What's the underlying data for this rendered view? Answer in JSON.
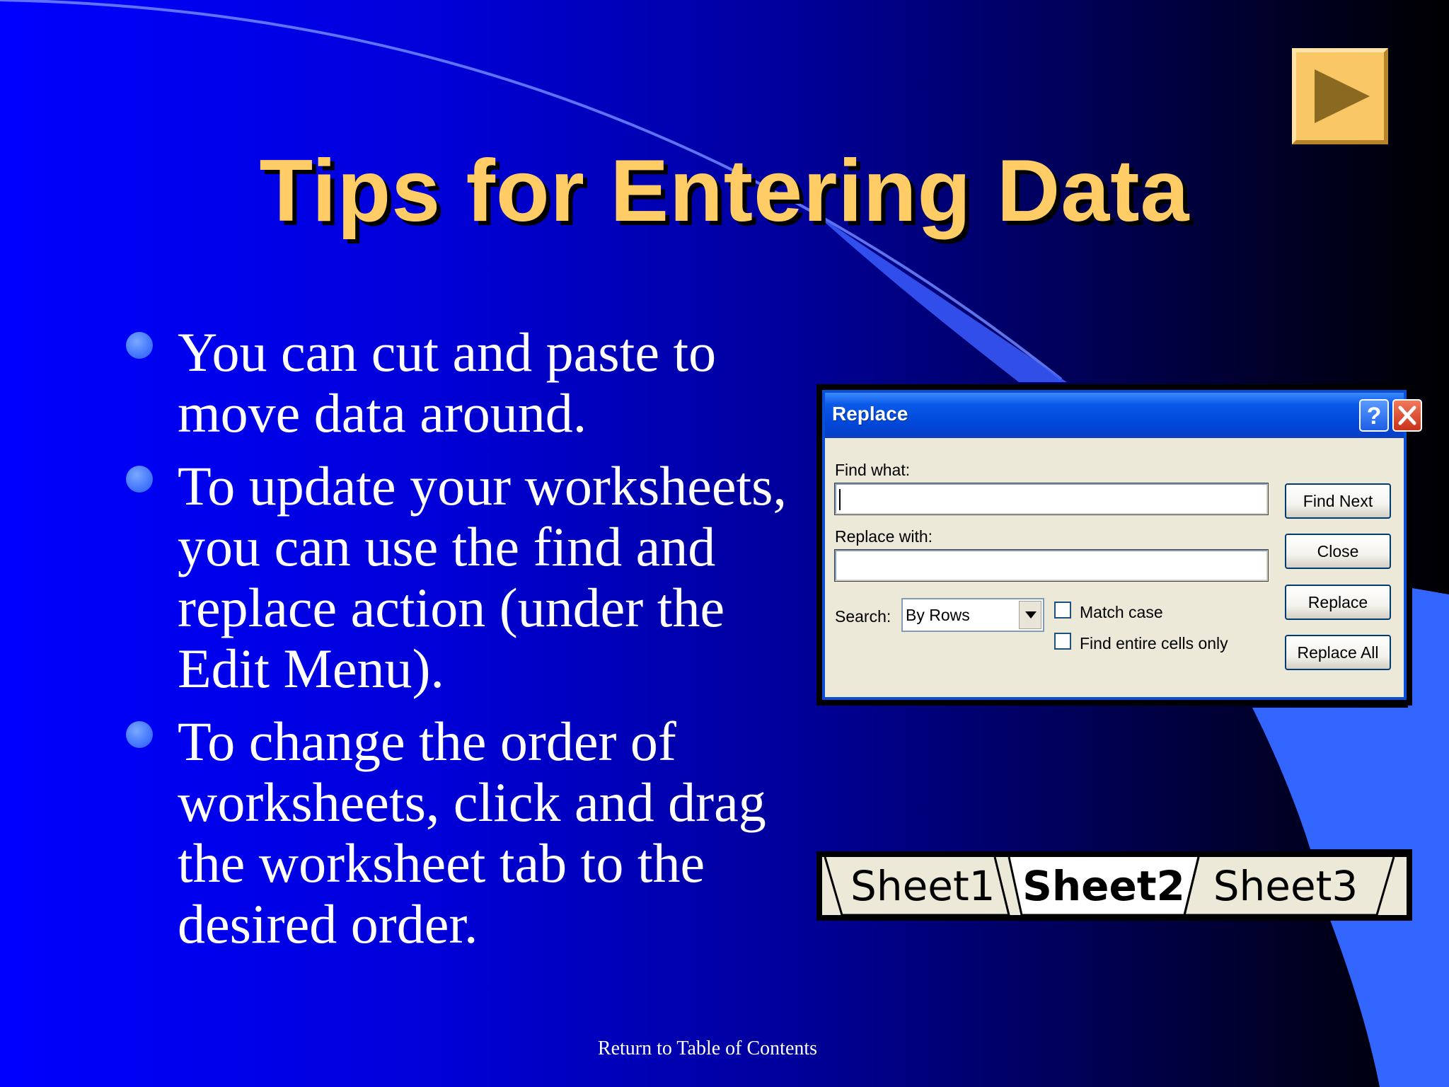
{
  "slide": {
    "title": "Tips for Entering Data",
    "bullets": [
      "You can cut and paste to move data around.",
      "To update your worksheets, you can use the find and replace action (under the Edit Menu).",
      "To change the order of worksheets, click and drag the worksheet tab to the desired order."
    ],
    "footer_link": "Return to Table of Contents"
  },
  "replace_dialog": {
    "title": "Replace",
    "help_label": "?",
    "find_what_label": "Find what:",
    "find_what_value": "",
    "replace_with_label": "Replace with:",
    "replace_with_value": "",
    "search_label": "Search:",
    "search_value": "By Rows",
    "match_case_label": "Match case",
    "match_case_checked": false,
    "find_entire_label": "Find entire cells only",
    "find_entire_checked": false,
    "buttons": {
      "find_next": "Find Next",
      "close": "Close",
      "replace": "Replace",
      "replace_all": "Replace All"
    }
  },
  "sheet_tabs": {
    "tabs": [
      "Sheet1",
      "Sheet2",
      "Sheet3"
    ],
    "active": "Sheet2"
  },
  "colors": {
    "title": "#ffcc66",
    "background_start": "#0000ff",
    "background_end": "#000000",
    "accent_shape": "#3366ff",
    "nav_button": "#f9c766"
  },
  "icons": {
    "next": "play-arrow-icon",
    "help": "help-icon",
    "close": "close-icon",
    "dropdown": "chevron-down-icon"
  }
}
